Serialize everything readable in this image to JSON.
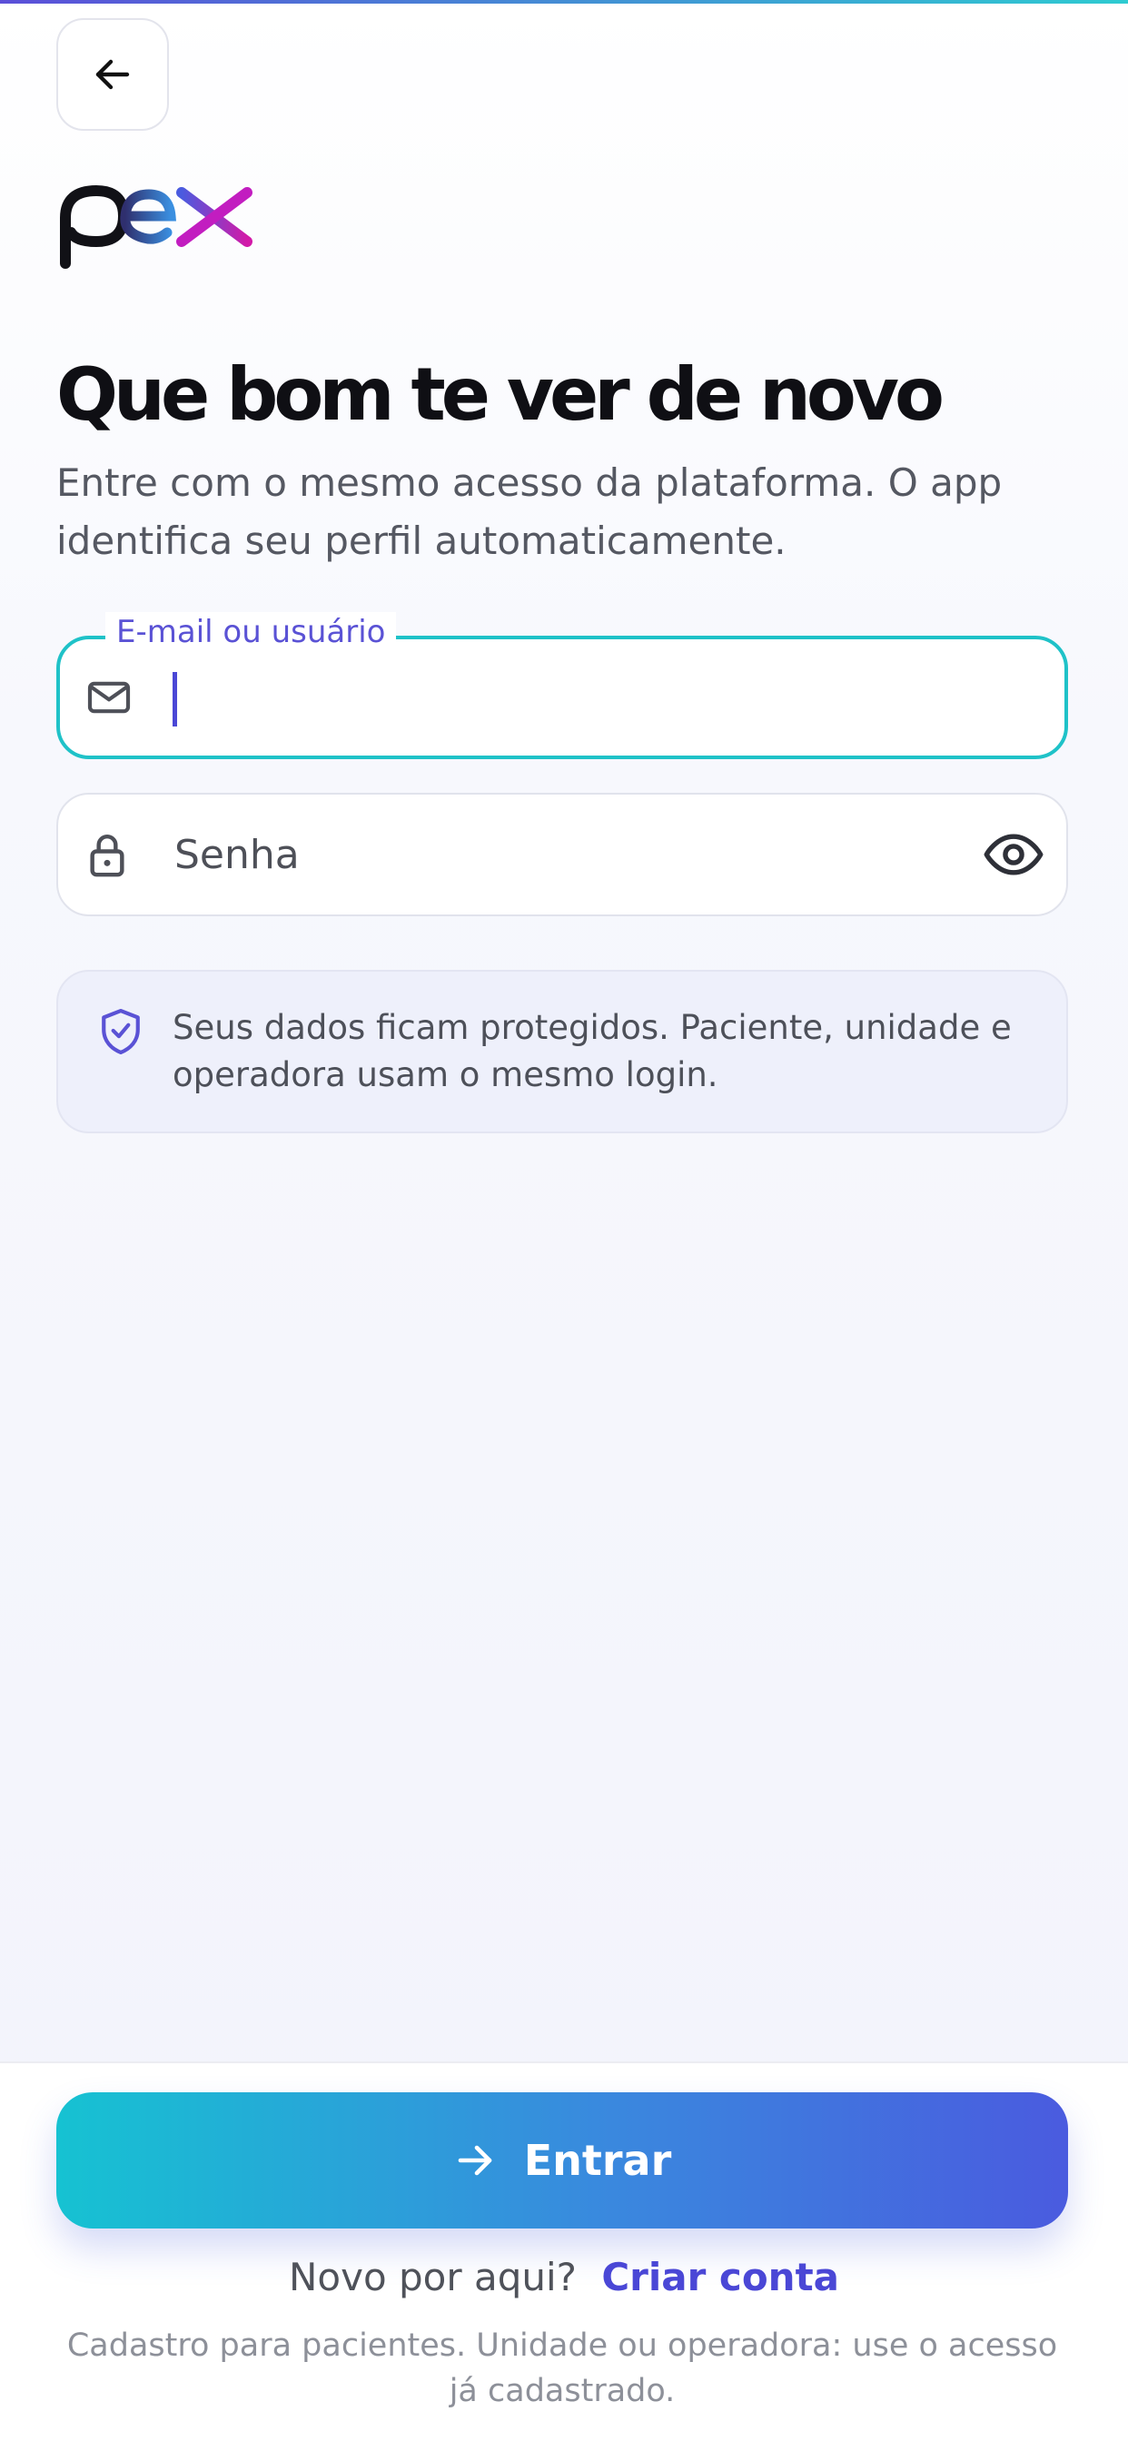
{
  "brand": {
    "logo_text": "pex",
    "colors": {
      "accent_indigo": "#4a47d6",
      "accent_teal": "#1fc2c8",
      "gradient_start": "#16c2d2",
      "gradient_end": "#4a5bdf",
      "logo_magenta": "#c21dc0"
    }
  },
  "header": {
    "back_icon": "arrow-left-icon"
  },
  "content": {
    "headline": "Que bom te ver de novo",
    "subtitle": "Entre com o mesmo acesso da plataforma. O app identifica seu perfil automaticamente."
  },
  "form": {
    "email": {
      "label": "E-mail ou usuário",
      "value": "",
      "icon": "mail-icon",
      "focused": true
    },
    "password": {
      "placeholder": "Senha",
      "value": "",
      "icon": "lock-icon",
      "toggle_icon": "eye-icon"
    }
  },
  "notice": {
    "icon": "shield-check-icon",
    "text": "Seus dados ficam protegidos. Paciente, unidade e operadora usam o mesmo login."
  },
  "footer": {
    "submit_label": "Entrar",
    "submit_icon": "arrow-right-icon",
    "signup_prompt": "Novo por aqui?",
    "signup_link": "Criar conta",
    "footnote": "Cadastro para pacientes. Unidade ou operadora: use o acesso já cadastrado."
  }
}
